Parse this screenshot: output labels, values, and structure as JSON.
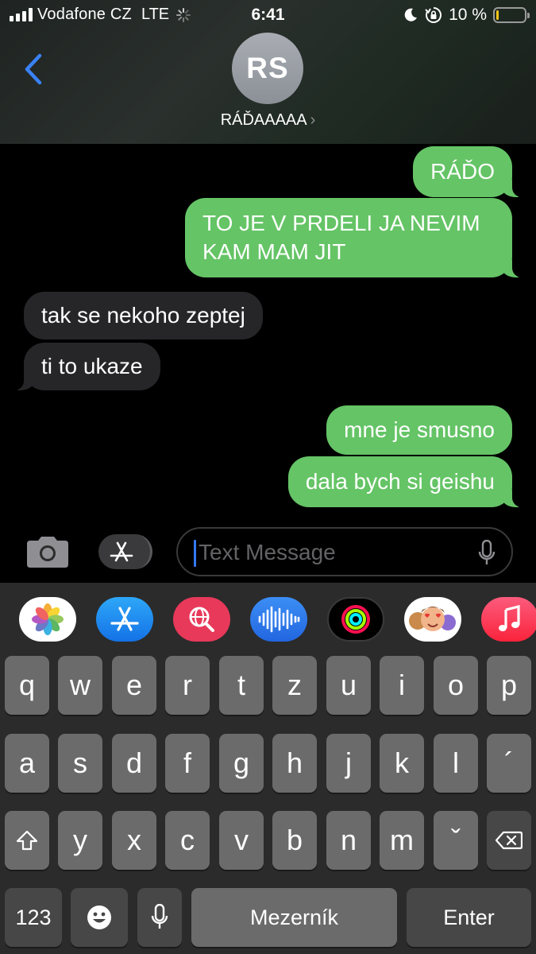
{
  "status_bar": {
    "carrier": "Vodafone CZ",
    "network": "LTE",
    "time": "6:41",
    "battery": "10 %",
    "battery_level": 0.1
  },
  "header": {
    "avatar_initials": "RS",
    "contact_name": "RÁĎAAAAA",
    "chevron": "›"
  },
  "messages": [
    {
      "direction": "outgoing",
      "text": "RÁĎO"
    },
    {
      "direction": "outgoing",
      "text": "TO JE V PRDELI JA NEVIM KAM MAM JIT"
    },
    {
      "direction": "incoming",
      "text": "tak se nekoho zeptej"
    },
    {
      "direction": "incoming",
      "text": "ti to ukaze"
    },
    {
      "direction": "outgoing",
      "text": "mne je smusno"
    },
    {
      "direction": "outgoing",
      "text": "dala bych si geishu"
    }
  ],
  "composer": {
    "placeholder": "Text Message"
  },
  "app_strip": [
    "photos-icon",
    "app-store-icon",
    "web-search-icon",
    "audio-message-icon",
    "activity-icon",
    "memoji-icon",
    "music-icon"
  ],
  "keyboard": {
    "row1": [
      "q",
      "w",
      "e",
      "r",
      "t",
      "z",
      "u",
      "i",
      "o",
      "p"
    ],
    "row2": [
      "a",
      "s",
      "d",
      "f",
      "g",
      "h",
      "j",
      "k",
      "l",
      "´"
    ],
    "row3": [
      "y",
      "x",
      "c",
      "v",
      "b",
      "n",
      "m",
      "ˇ"
    ],
    "numbers_label": "123",
    "space_label": "Mezerník",
    "enter_label": "Enter"
  },
  "colors": {
    "outgoing_bubble": "#65c466",
    "incoming_bubble": "#262629",
    "accent": "#3478f6"
  }
}
